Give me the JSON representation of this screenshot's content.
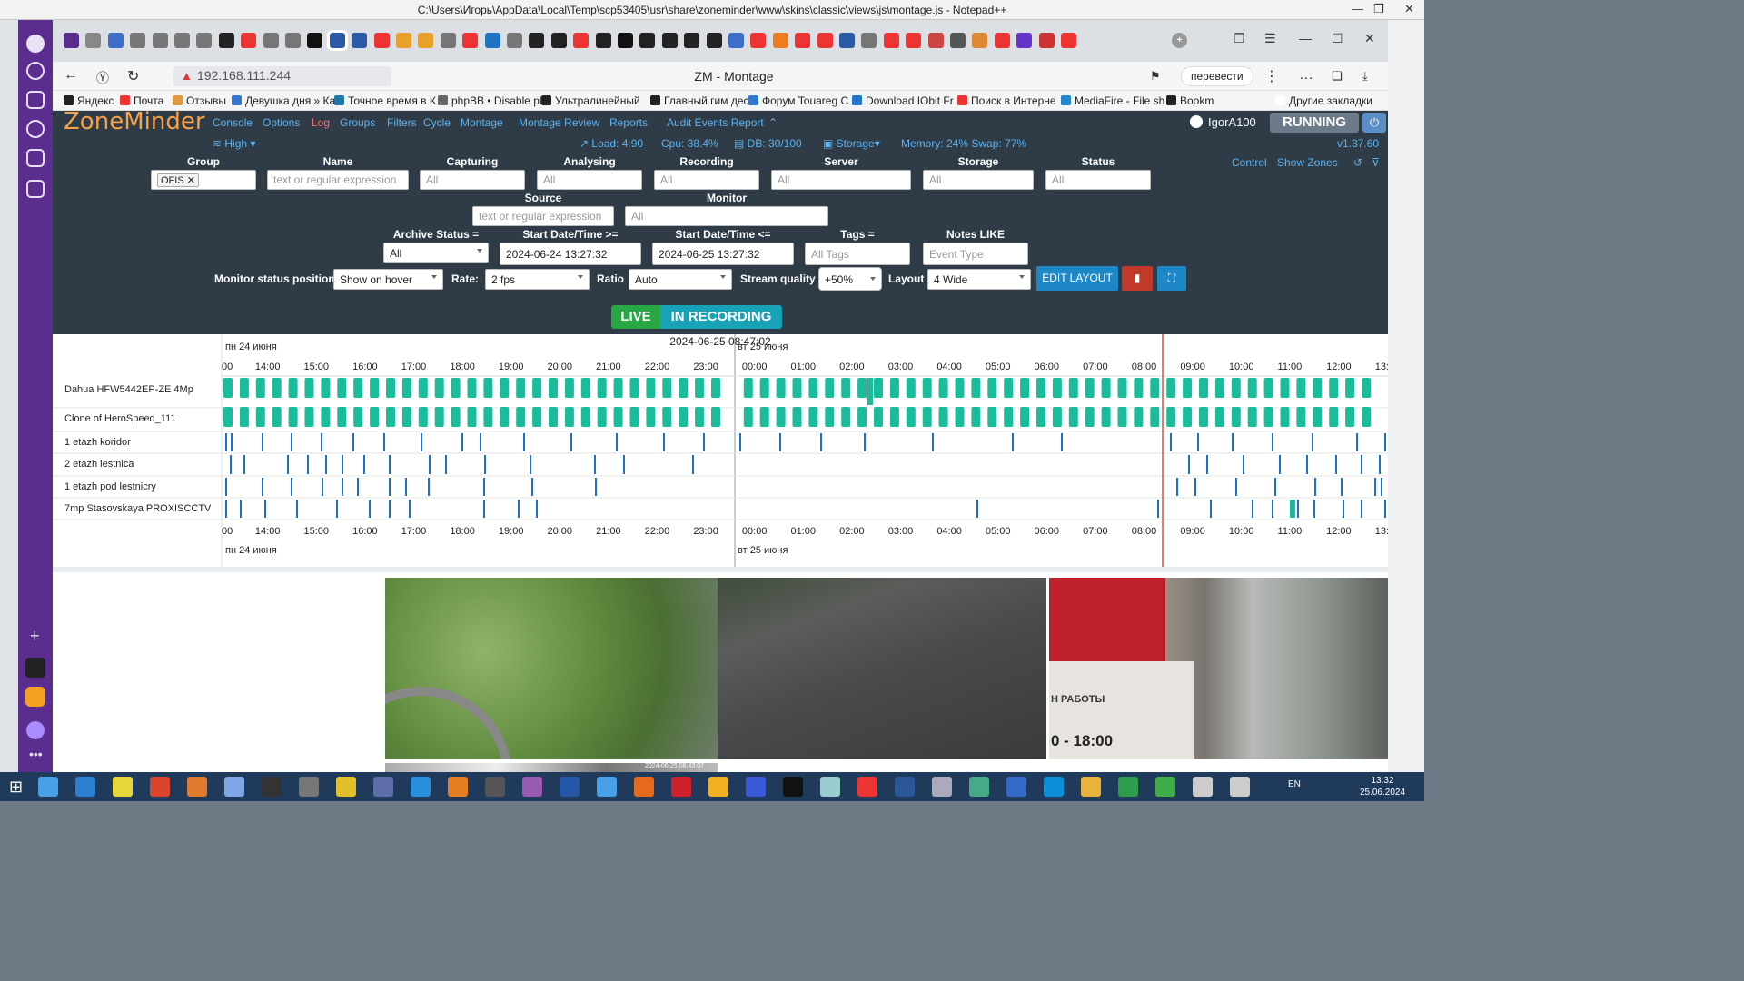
{
  "window": {
    "title": "C:\\Users\\Игорь\\AppData\\Local\\Temp\\scp53405\\usr\\share\\zoneminder\\www\\skins\\classic\\views\\js\\montage.js - Notepad++"
  },
  "browser": {
    "url": "192.168.111.244",
    "page_title": "ZM - Montage",
    "translate_label": "перевести",
    "bookmarks": [
      "Яндекс",
      "Почта",
      "Отзывы",
      "Девушка дня » Ка",
      "Точное время в К",
      "phpBB • Disable pl",
      "Ультралинейный",
      "Главный гим деса",
      "Форум Touareg C",
      "Download IObit Fr",
      "Поиск в Интерне",
      "MediaFire - File sh",
      "Bookm",
      "Другие закладки"
    ]
  },
  "zm": {
    "logo": "ZoneMinder",
    "nav": [
      {
        "label": "Console",
        "active": false
      },
      {
        "label": "Options",
        "active": false
      },
      {
        "label": "Log",
        "active": true
      },
      {
        "label": "Groups",
        "active": false
      },
      {
        "label": "Filters",
        "active": false
      },
      {
        "label": "Cycle",
        "active": false
      },
      {
        "label": "Montage",
        "active": false
      },
      {
        "label": "Montage Review",
        "active": false
      },
      {
        "label": "Reports",
        "active": false
      },
      {
        "label": "Audit Events Report",
        "active": false
      }
    ],
    "user": "IgorA100",
    "state": "RUNNING",
    "bandwidth": "High",
    "load": "Load: 4.90",
    "cpu": "Cpu: 38.4%",
    "db": "DB: 30/100",
    "storage": "Storage",
    "memory": "Memory: 24% Swap: 77%",
    "version": "v1.37.60",
    "links": {
      "control": "Control",
      "show_zones": "Show Zones"
    }
  },
  "filters": {
    "group": {
      "label": "Group",
      "chip": "OFIS"
    },
    "name": {
      "label": "Name",
      "placeholder": "text or regular expression"
    },
    "capturing": {
      "label": "Capturing",
      "placeholder": "All"
    },
    "analysing": {
      "label": "Analysing",
      "placeholder": "All"
    },
    "recording": {
      "label": "Recording",
      "placeholder": "All"
    },
    "server": {
      "label": "Server",
      "placeholder": "All"
    },
    "storage": {
      "label": "Storage",
      "placeholder": "All"
    },
    "status": {
      "label": "Status",
      "placeholder": "All"
    },
    "source": {
      "label": "Source",
      "placeholder": "text or regular expression"
    },
    "monitor": {
      "label": "Monitor",
      "placeholder": "All"
    },
    "archive": {
      "label": "Archive Status =",
      "value": "All"
    },
    "start_ge": {
      "label": "Start Date/Time >=",
      "value": "2024-06-24 13:27:32"
    },
    "start_le": {
      "label": "Start Date/Time <=",
      "value": "2024-06-25 13:27:32"
    },
    "tags": {
      "label": "Tags =",
      "placeholder": "All Tags"
    },
    "notes": {
      "label": "Notes LIKE",
      "placeholder": "Event Type"
    }
  },
  "controls": {
    "status_pos": {
      "label": "Monitor status position",
      "value": "Show on hover"
    },
    "rate": {
      "label": "Rate:",
      "value": "2 fps"
    },
    "ratio": {
      "label": "Ratio",
      "value": "Auto"
    },
    "quality": {
      "label": "Stream quality",
      "value": "+50%"
    },
    "layout": {
      "label": "Layout",
      "value": "4 Wide"
    },
    "edit_layout": "EDIT LAYOUT",
    "live": "LIVE",
    "in_recording": "IN RECORDING"
  },
  "timeline": {
    "day1": "пн 24 июня",
    "day2": "вт 25 июня",
    "hours": [
      "00",
      "14:00",
      "15:00",
      "16:00",
      "17:00",
      "18:00",
      "19:00",
      "20:00",
      "21:00",
      "22:00",
      "23:00",
      "00:00",
      "01:00",
      "02:00",
      "03:00",
      "04:00",
      "05:00",
      "06:00",
      "07:00",
      "08:00",
      "09:00",
      "10:00",
      "11:00",
      "12:00",
      "13:"
    ],
    "monitors": [
      "Dahua HFW5442EP-ZE 4Mp",
      "Clone of HeroSpeed_111",
      "1 etazh koridor",
      "2 etazh lestnica",
      "1 etazh pod lestnicry",
      "7mp Stasovskaya PROXISCCTV"
    ],
    "cursor_time": "2024-06-25 08:47:02"
  },
  "cameras": {
    "overlay_time": "2024-06-25 08:43:07",
    "sign_text_1": "Н РАБОТЫ",
    "sign_text_2": "0 - 18:00"
  },
  "taskbar": {
    "lang": "EN",
    "time": "13:32",
    "date": "25.06.2024"
  },
  "colors": {
    "accent": "#5ab3f0",
    "header": "#2f3b47",
    "event": "#1abc9c",
    "alarm": "#1a73c9",
    "cursor": "#e74c3c",
    "logo": "#f4a24a"
  }
}
